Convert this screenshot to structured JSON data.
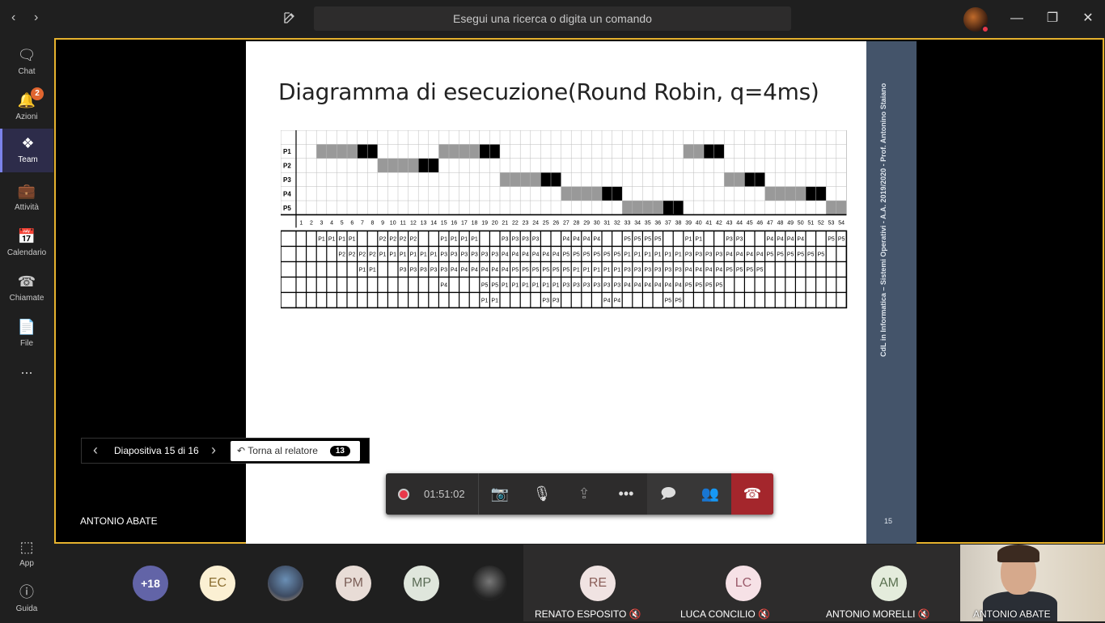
{
  "titlebar": {
    "search_placeholder": "Esegui una ricerca o digita un comando",
    "back_icon": "chevron-left-icon",
    "forward_icon": "chevron-right-icon"
  },
  "rail": {
    "items": [
      {
        "label": "Chat",
        "icon": "chat-icon"
      },
      {
        "label": "Azioni",
        "icon": "bell-icon",
        "badge": "2"
      },
      {
        "label": "Team",
        "icon": "team-icon",
        "active": true
      },
      {
        "label": "Attività",
        "icon": "briefcase-icon"
      },
      {
        "label": "Calendario",
        "icon": "calendar-icon"
      },
      {
        "label": "Chiamate",
        "icon": "phone-icon"
      },
      {
        "label": "File",
        "icon": "file-icon"
      },
      {
        "label": "...",
        "icon": "more-icon"
      }
    ],
    "bottom": [
      {
        "label": "App",
        "icon": "apps-icon"
      },
      {
        "label": "Guida",
        "icon": "help-icon"
      }
    ]
  },
  "slide": {
    "title": "Diagramma di esecuzione(Round Robin, q=4ms)",
    "sidebar_text": "CdL in Informatica – Sistemi Operativi - A.A. 2019/2020 - Prof. Antonino Staiano",
    "number": "15",
    "gantt": {
      "processes": [
        "P1",
        "P2",
        "P3",
        "P4",
        "P5"
      ],
      "time_labels": [
        "1",
        "2",
        "3",
        "4",
        "5",
        "6",
        "7",
        "8",
        "9",
        "10",
        "11",
        "12",
        "13",
        "14",
        "15",
        "16",
        "17",
        "18",
        "19",
        "20",
        "21",
        "22",
        "23",
        "24",
        "25",
        "26",
        "27",
        "28",
        "29",
        "30",
        "31",
        "32",
        "33",
        "34",
        "35",
        "36",
        "37",
        "38",
        "39",
        "40",
        "41",
        "42",
        "43",
        "44",
        "45",
        "46",
        "47",
        "48",
        "49",
        "50",
        "51",
        "52",
        "53",
        "54"
      ],
      "colors": {
        "wait": "#999999",
        "run": "#000000"
      },
      "ready_queue": [
        [
          "",
          "",
          "P1",
          "P1",
          "P1",
          "P1",
          "",
          "",
          "P2",
          "P2",
          "P2",
          "P2",
          "",
          "",
          "P1",
          "P1",
          "P1",
          "P1",
          "",
          "",
          "P3",
          "P3",
          "P3",
          "P3",
          "",
          "",
          "P4",
          "P4",
          "P4",
          "P4",
          "",
          "",
          "P5",
          "P5",
          "P5",
          "P5",
          "",
          "",
          "P1",
          "P1",
          "",
          "",
          "P3",
          "P3",
          "",
          "",
          "P4",
          "P4",
          "P4",
          "P4",
          "",
          "",
          "P5",
          "P5"
        ],
        [
          "",
          "",
          "",
          "",
          "P2",
          "P2",
          "P2",
          "P2",
          "P1",
          "P1",
          "P1",
          "P1",
          "P1",
          "P1",
          "P3",
          "P3",
          "P3",
          "P3",
          "P3",
          "P3",
          "P4",
          "P4",
          "P4",
          "P4",
          "P4",
          "P4",
          "P5",
          "P5",
          "P5",
          "P5",
          "P5",
          "P5",
          "P1",
          "P1",
          "P1",
          "P1",
          "P1",
          "P1",
          "P3",
          "P3",
          "P3",
          "P3",
          "P4",
          "P4",
          "P4",
          "P4",
          "P5",
          "P5",
          "P5",
          "P5",
          "P5",
          "P5",
          "",
          ""
        ],
        [
          "",
          "",
          "",
          "",
          "",
          "",
          "P1",
          "P1",
          "",
          "",
          "P3",
          "P3",
          "P3",
          "P3",
          "P3",
          "P4",
          "P4",
          "P4",
          "P4",
          "P4",
          "P4",
          "P5",
          "P5",
          "P5",
          "P5",
          "P5",
          "P5",
          "P1",
          "P1",
          "P1",
          "P1",
          "P1",
          "P3",
          "P3",
          "P3",
          "P3",
          "P3",
          "P3",
          "P4",
          "P4",
          "P4",
          "P4",
          "P5",
          "P5",
          "P5",
          "P5",
          "",
          "",
          "",
          "",
          "",
          "",
          "",
          ""
        ],
        [
          "",
          "",
          "",
          "",
          "",
          "",
          "",
          "",
          "",
          "",
          "",
          "",
          "",
          "",
          "P4",
          "",
          "",
          "",
          "P5",
          "P5",
          "P1",
          "P1",
          "P1",
          "P1",
          "P1",
          "P1",
          "P3",
          "P3",
          "P3",
          "P3",
          "P3",
          "P3",
          "P4",
          "P4",
          "P4",
          "P4",
          "P4",
          "P4",
          "P5",
          "P5",
          "P5",
          "P5",
          "",
          "",
          "",
          "",
          "",
          "",
          "",
          "",
          "",
          "",
          "",
          ""
        ],
        [
          "",
          "",
          "",
          "",
          "",
          "",
          "",
          "",
          "",
          "",
          "",
          "",
          "",
          "",
          "",
          "",
          "",
          "",
          "P1",
          "P1",
          "",
          "",
          "",
          "",
          "P3",
          "P3",
          "",
          "",
          "",
          "",
          "P4",
          "P4",
          "",
          "",
          "",
          "",
          "P5",
          "P5",
          "",
          "",
          "",
          "",
          "",
          "",
          "",
          "",
          "",
          "",
          "",
          "",
          "",
          "",
          "",
          ""
        ]
      ]
    }
  },
  "slidenav": {
    "label": "Diapositiva 15 di 16",
    "back_label": "Torna al relatore",
    "count": "13"
  },
  "presenter": {
    "name": "ANTONIO ABATE"
  },
  "callbar": {
    "timer": "01:51:02",
    "buttons": [
      "camera-off-icon",
      "mic-off-icon",
      "share-icon",
      "more-icon",
      "chat-icon",
      "participants-icon"
    ],
    "hangup": "hangup-icon"
  },
  "participants": {
    "overflow": "+18",
    "avatars": [
      {
        "initials": "EC",
        "color": "#fbf0d3"
      },
      {
        "initials": "",
        "photo": true
      },
      {
        "initials": "PM",
        "color": "#e8dcd6"
      },
      {
        "initials": "MP",
        "color": "#dfe6dc"
      },
      {
        "initials": "",
        "photo": true
      }
    ],
    "tiles": [
      {
        "initials": "RE",
        "name": "RENATO ESPOSITO",
        "color": "#f0e3e2"
      },
      {
        "initials": "LC",
        "name": "LUCA CONCILIO",
        "color": "#f6e1e6"
      },
      {
        "initials": "AM",
        "name": "ANTONIO MORELLI",
        "color": "#e4ecdc"
      }
    ],
    "self": {
      "name": "ANTONIO ABATE"
    }
  }
}
